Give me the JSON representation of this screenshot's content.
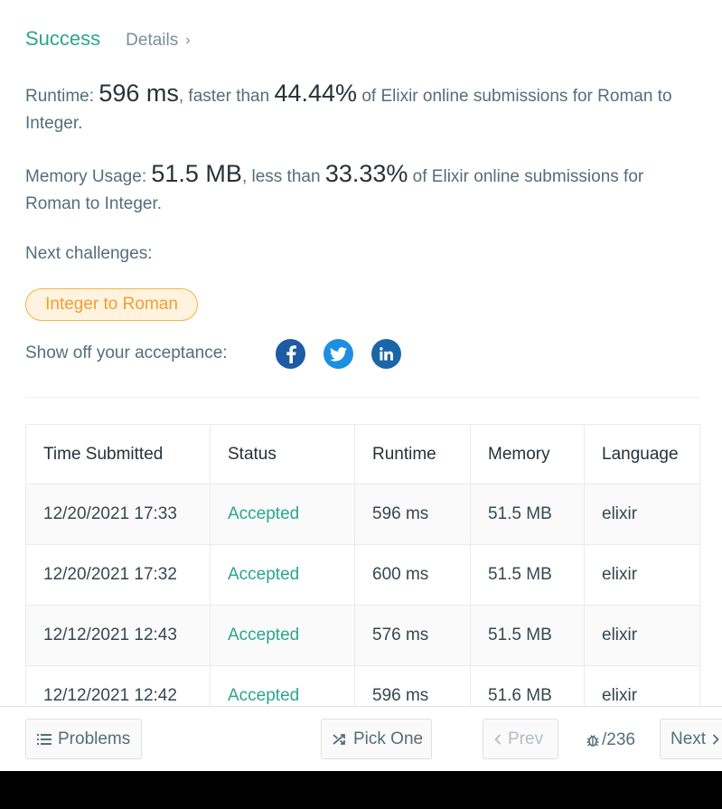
{
  "result": {
    "status": "Success",
    "details_label": "Details",
    "runtime": {
      "label": "Runtime: ",
      "value": "596 ms",
      "middle": ", faster than ",
      "percent": "44.44%",
      "suffix": " of Elixir online submissions for Roman to Integer."
    },
    "memory": {
      "label": "Memory Usage: ",
      "value": "51.5 MB",
      "middle": ", less than ",
      "percent": "33.33%",
      "suffix": " of Elixir online submissions for Roman to Integer."
    },
    "next_label": "Next challenges:",
    "next_challenge": "Integer to Roman",
    "share_label": "Show off your acceptance:",
    "social_icons": [
      "facebook-icon",
      "twitter-icon",
      "linkedin-icon"
    ]
  },
  "table": {
    "headers": [
      "Time Submitted",
      "Status",
      "Runtime",
      "Memory",
      "Language"
    ],
    "rows": [
      [
        "12/20/2021 17:33",
        "Accepted",
        "596 ms",
        "51.5 MB",
        "elixir"
      ],
      [
        "12/20/2021 17:32",
        "Accepted",
        "600 ms",
        "51.5 MB",
        "elixir"
      ],
      [
        "12/12/2021 12:43",
        "Accepted",
        "576 ms",
        "51.5 MB",
        "elixir"
      ],
      [
        "12/12/2021 12:42",
        "Accepted",
        "596 ms",
        "51.6 MB",
        "elixir"
      ]
    ]
  },
  "bottom_bar": {
    "problems_label": "Problems",
    "pick_one_label": "Pick One",
    "prev_label": "Prev",
    "counter": "/236",
    "next_label": "Next"
  },
  "colors": {
    "success": "#2ca58d",
    "challenge_border": "#f2b148",
    "challenge_text": "#f0a030",
    "facebook": "#1d5ba4",
    "twitter": "#1d8fe0",
    "linkedin": "#1b66a8"
  }
}
